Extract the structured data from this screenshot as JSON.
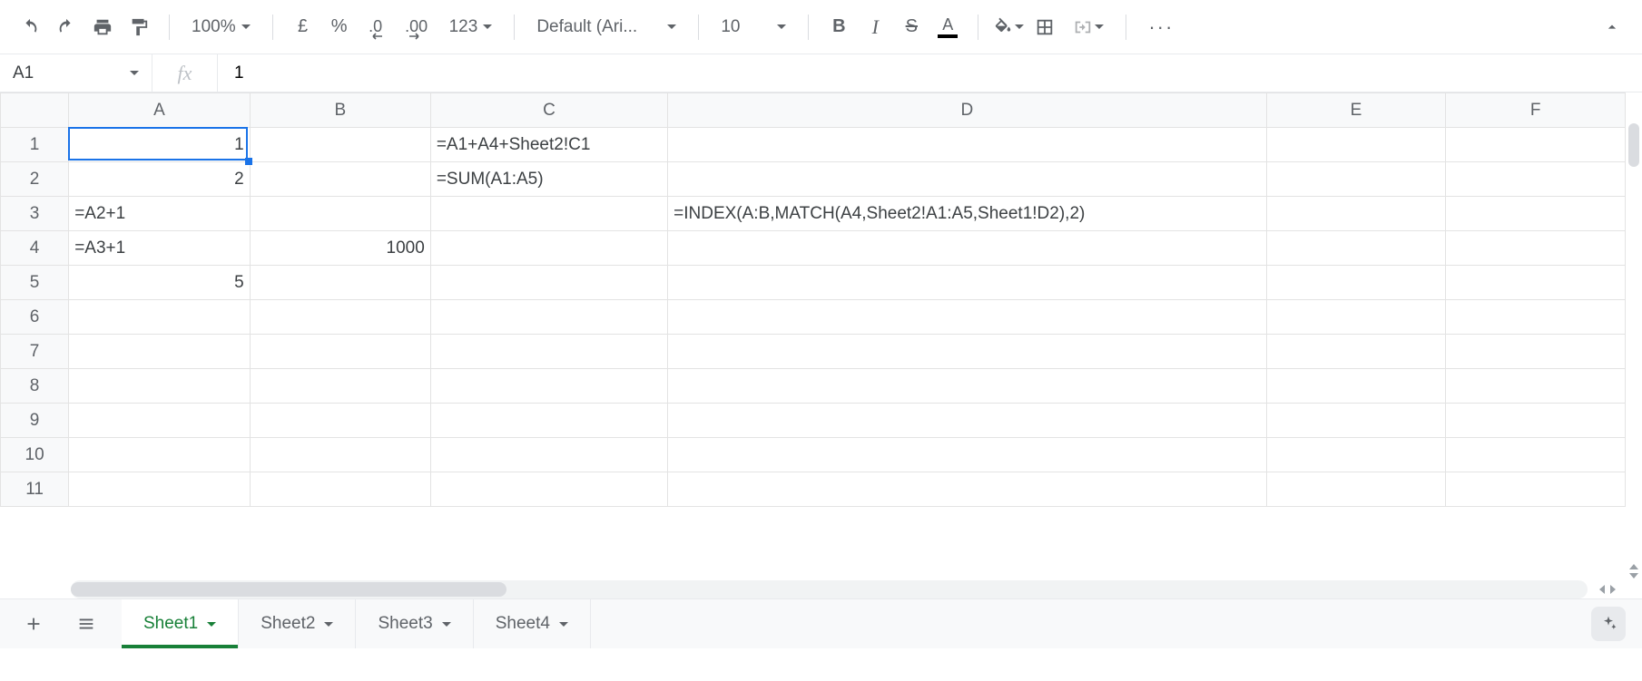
{
  "toolbar": {
    "zoom": "100%",
    "currency_symbol": "£",
    "percent_symbol": "%",
    "dec_decrease": ".0",
    "dec_increase": ".00",
    "num_format": "123",
    "font": "Default (Ari...",
    "font_size": "10"
  },
  "namebox": {
    "ref": "A1"
  },
  "formula": {
    "fx": "fx",
    "value": "1"
  },
  "columns": [
    "A",
    "B",
    "C",
    "D",
    "E",
    "F"
  ],
  "rows": [
    "1",
    "2",
    "3",
    "4",
    "5",
    "6",
    "7",
    "8",
    "9",
    "10",
    "11"
  ],
  "selected_cell": "A1",
  "cells": {
    "A1": {
      "v": "1",
      "align": "num"
    },
    "A2": {
      "v": "2",
      "align": "num"
    },
    "A3": {
      "v": "=A2+1",
      "align": "txt"
    },
    "A4": {
      "v": "=A3+1",
      "align": "txt"
    },
    "A5": {
      "v": "5",
      "align": "num"
    },
    "B4": {
      "v": "1000",
      "align": "num"
    },
    "C1": {
      "v": "=A1+A4+Sheet2!C1",
      "align": "txt"
    },
    "C2": {
      "v": "=SUM(A1:A5)",
      "align": "txt"
    },
    "D3": {
      "v": "=INDEX(A:B,MATCH(A4,Sheet2!A1:A5,Sheet1!D2),2)",
      "align": "txt"
    }
  },
  "sheets": {
    "active": "Sheet1",
    "tabs": [
      "Sheet1",
      "Sheet2",
      "Sheet3",
      "Sheet4"
    ]
  },
  "icons": {
    "undo": "undo",
    "redo": "redo",
    "print": "print",
    "paint": "paint-format",
    "bold": "B",
    "italic": "I",
    "strike": "S",
    "textcolor": "A",
    "fill": "fill",
    "borders": "borders",
    "merge": "merge",
    "more": "more",
    "collapse": "collapse",
    "add": "add",
    "allsheets": "all-sheets",
    "explore": "explore"
  }
}
